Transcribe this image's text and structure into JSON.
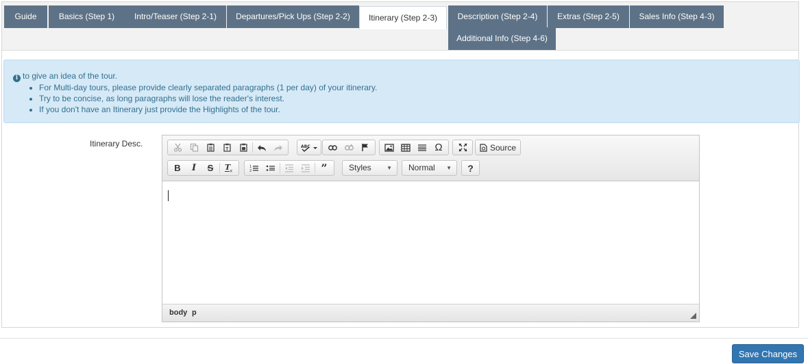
{
  "tabs": [
    {
      "label": "Guide"
    },
    {
      "label": "Basics (Step 1)"
    },
    {
      "label": "Intro/Teaser (Step 2-1)"
    },
    {
      "label": "Departures/Pick Ups (Step 2-2)"
    },
    {
      "label": "Itinerary (Step 2-3)",
      "active": true
    },
    {
      "label": "Description (Step 2-4)"
    },
    {
      "label": "Extras (Step 2-5)"
    },
    {
      "label": "Sales Info (Step 4-3)"
    },
    {
      "label": "Additional Info (Step 4-6)"
    }
  ],
  "alert": {
    "intro": "to give an idea of the tour.",
    "items": [
      "For Multi-day tours, please provide clearly separated paragraphs (1 per day) of your itinerary.",
      "Try to be concise, as long paragraphs will lose the reader's interest.",
      "If you don't have an Itinerary just provide the Highlights of the tour."
    ]
  },
  "form": {
    "field_label": "Itinerary Desc."
  },
  "editor": {
    "source_label": "Source",
    "styles_label": "Styles",
    "format_label": "Normal",
    "help_label": "?",
    "path": [
      "body",
      "p"
    ],
    "content": ""
  },
  "footer": {
    "save_label": "Save Changes"
  },
  "colors": {
    "tab_bg": "#5d7287",
    "alert_bg": "#d6e9f6",
    "alert_text": "#31708f",
    "primary": "#3276b1"
  }
}
